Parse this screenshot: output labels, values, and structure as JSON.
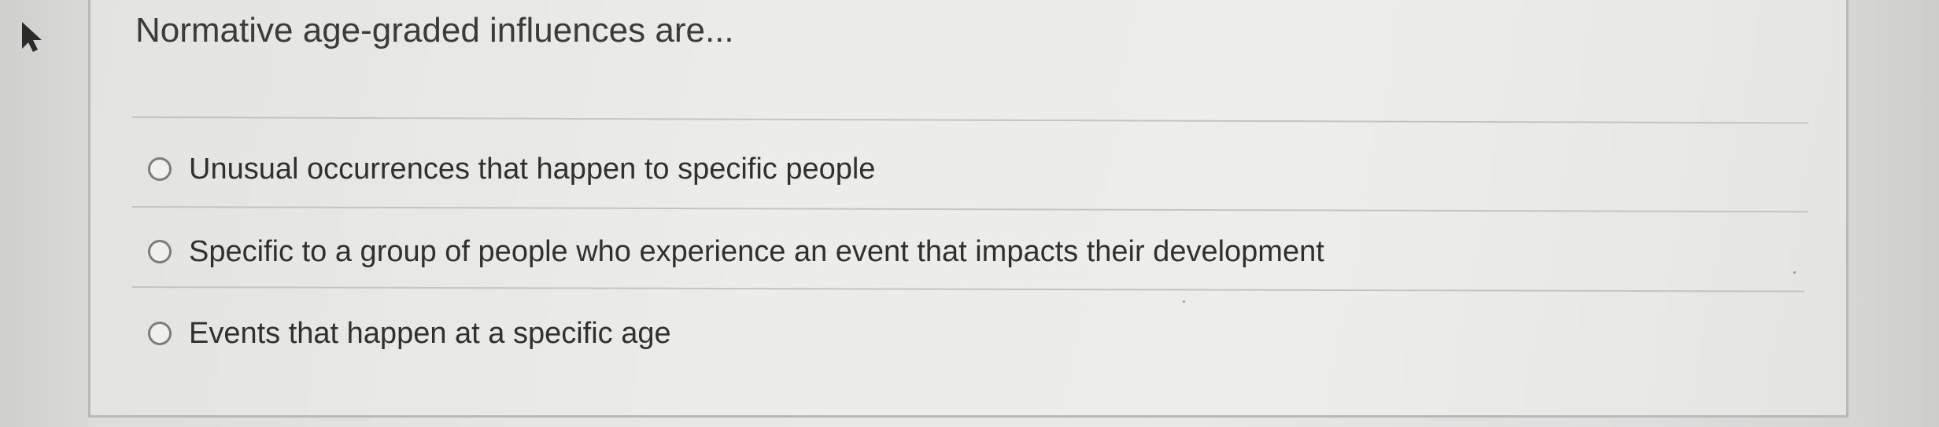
{
  "question": {
    "prompt": "Normative age-graded influences are..."
  },
  "options": [
    {
      "label": "Unusual occurrences that happen to specific people",
      "selected": false
    },
    {
      "label": "Specific to a group of people who experience an event that impacts their development",
      "selected": false
    },
    {
      "label": "Events that happen at a specific age",
      "selected": false
    }
  ],
  "icons": {
    "marker": "cursor-arrow-icon"
  }
}
